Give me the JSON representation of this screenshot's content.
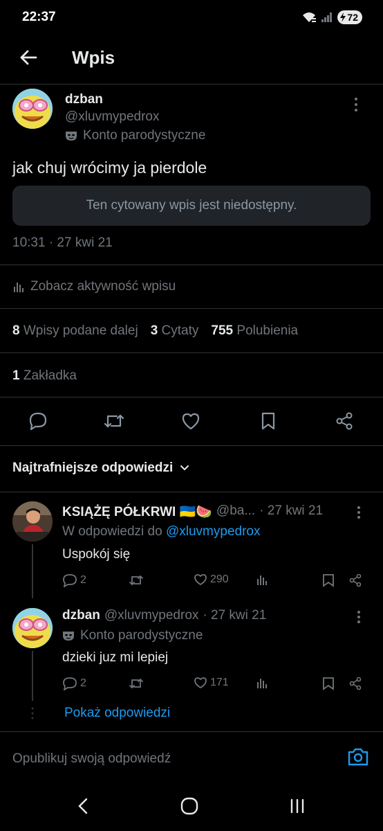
{
  "status_bar": {
    "time": "22:37",
    "battery": "72",
    "icons": [
      "wifi-icon",
      "signal-icon",
      "battery-icon"
    ]
  },
  "header": {
    "title": "Wpis",
    "back_icon": "arrow-left-icon"
  },
  "tweet": {
    "author_name": "dzban",
    "author_handle": "@xluvmypedrox",
    "parody_label": "Konto parodystyczne",
    "text": "jak chuj wrócimy ja pierdole",
    "quote_unavailable": "Ten cytowany wpis jest niedostępny.",
    "timestamp": "10:31 · 27 kwi 21",
    "activity_label": "Zobacz aktywność wpisu",
    "stats": {
      "retweets_count": "8",
      "retweets_label": "Wpisy podane dalej",
      "quotes_count": "3",
      "quotes_label": "Cytaty",
      "likes_count": "755",
      "likes_label": "Polubienia"
    },
    "bookmarks_count": "1",
    "bookmarks_label": "Zakładka",
    "actions": [
      "reply-icon",
      "retweet-icon",
      "like-icon",
      "bookmark-icon",
      "share-icon"
    ]
  },
  "replies_sort": {
    "label": "Najtrafniejsze odpowiedzi"
  },
  "replies": [
    {
      "name": "KSIĄŻĘ PÓŁKRWI 🇺🇦🍉",
      "handle": "@ba...",
      "date": "· 27 kwi 21",
      "replying_to_label": "W odpowiedzi do",
      "replying_to_handle": "@xluvmypedrox",
      "text": "Uspokój się",
      "replies": "2",
      "retweets": "",
      "likes": "290"
    },
    {
      "name": "dzban",
      "handle": "@xluvmypedrox",
      "date": "· 27 kwi 21",
      "parody_label": "Konto parodystyczne",
      "text": "dzieki juz mi lepiej",
      "replies": "2",
      "retweets": "",
      "likes": "171"
    }
  ],
  "show_replies": "Pokaż odpowiedzi",
  "compose": {
    "placeholder": "Opublikuj swoją odpowiedź"
  },
  "colors": {
    "background": "#000000",
    "text": "#e7e9ea",
    "muted": "#71767b",
    "accent": "#1d9bf0",
    "divider": "#2f3336"
  }
}
